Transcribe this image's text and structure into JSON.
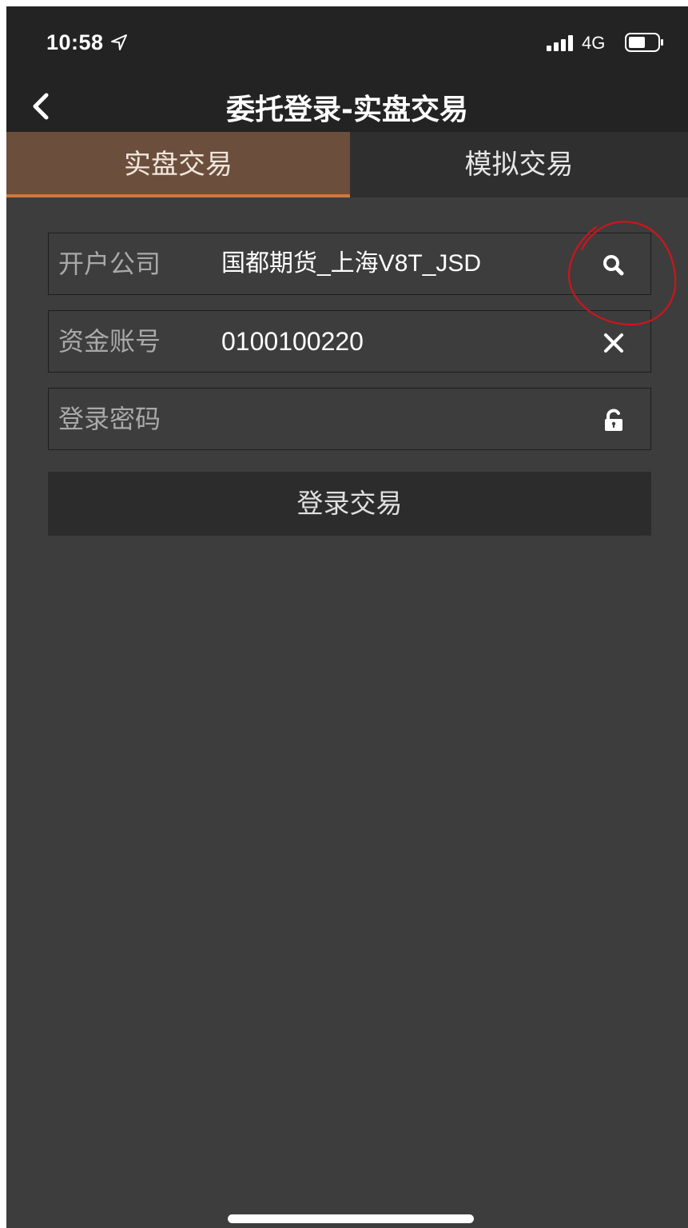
{
  "status_bar": {
    "time": "10:58",
    "network": "4G",
    "icons": [
      "location-arrow-icon",
      "signal-icon",
      "battery-icon"
    ]
  },
  "nav": {
    "title": "委托登录-实盘交易",
    "back_icon": "chevron-left-icon"
  },
  "tabs": [
    {
      "label": "实盘交易",
      "active": true
    },
    {
      "label": "模拟交易",
      "active": false
    }
  ],
  "form": {
    "company": {
      "label": "开户公司",
      "value": "国都期货_上海V8T_JSD",
      "icon": "search-icon"
    },
    "account": {
      "label": "资金账号",
      "value": "0100100220",
      "icon": "clear-icon"
    },
    "password": {
      "label": "登录密码",
      "value": "",
      "icon": "unlock-icon"
    },
    "submit_label": "登录交易"
  },
  "colors": {
    "background": "#3d3d3d",
    "topbar": "#232323",
    "active_tab": "#6b4f3c",
    "active_tab_underline": "#d2783a",
    "annotation": "#d0141c"
  }
}
